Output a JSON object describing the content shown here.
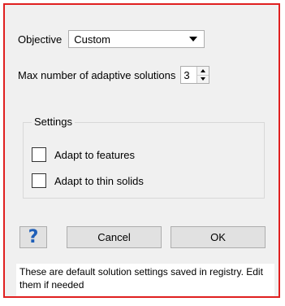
{
  "objective": {
    "label": "Objective",
    "selected": "Custom"
  },
  "max_solutions": {
    "label": "Max number of adaptive solutions",
    "value": "3"
  },
  "settings": {
    "title": "Settings",
    "items": [
      {
        "label": "Adapt to features",
        "checked": false
      },
      {
        "label": "Adapt to thin solids",
        "checked": false
      }
    ]
  },
  "buttons": {
    "help": "?",
    "cancel": "Cancel",
    "ok": "OK"
  },
  "note": "These are default solution settings saved in registry. Edit them if needed",
  "colors": {
    "highlight_border": "#e02020",
    "help_icon": "#1f5fb8"
  }
}
